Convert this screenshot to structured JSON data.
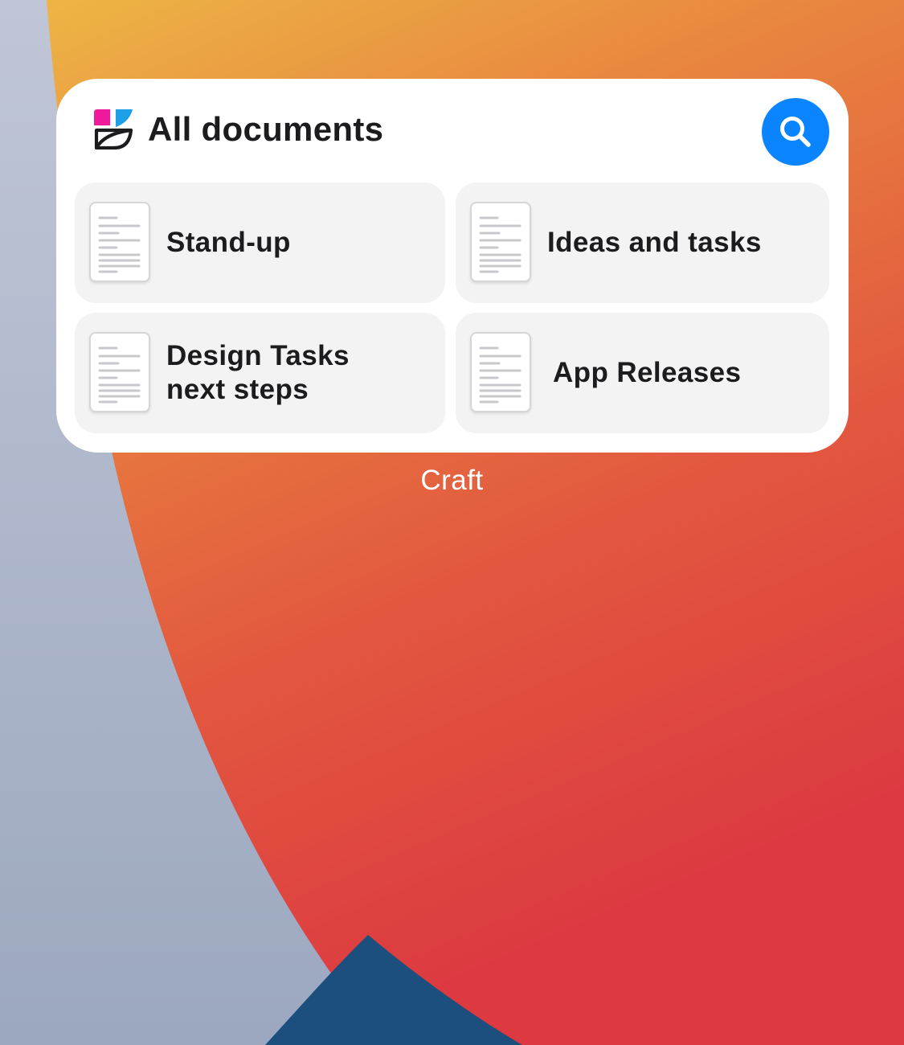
{
  "widget": {
    "title": "All documents",
    "logo_icon": "craft-logo-icon",
    "search_icon": "search-icon",
    "documents": [
      {
        "label": "Stand-up",
        "icon": "document-icon"
      },
      {
        "label": "Ideas and tasks",
        "icon": "document-icon"
      },
      {
        "label": "Design Tasks next steps",
        "icon": "document-icon"
      },
      {
        "label": "App Releases",
        "icon": "document-icon"
      }
    ]
  },
  "caption": "Craft",
  "colors": {
    "accent": "#0a84ff",
    "logo_magenta": "#f0199b",
    "logo_cyan": "#1ea0e8",
    "wallpaper_yellow": "#edb244",
    "wallpaper_orange": "#e8823f",
    "wallpaper_red": "#e03d3f",
    "wallpaper_gray": "#b4bccf",
    "wallpaper_blue": "#1c4e7e"
  }
}
